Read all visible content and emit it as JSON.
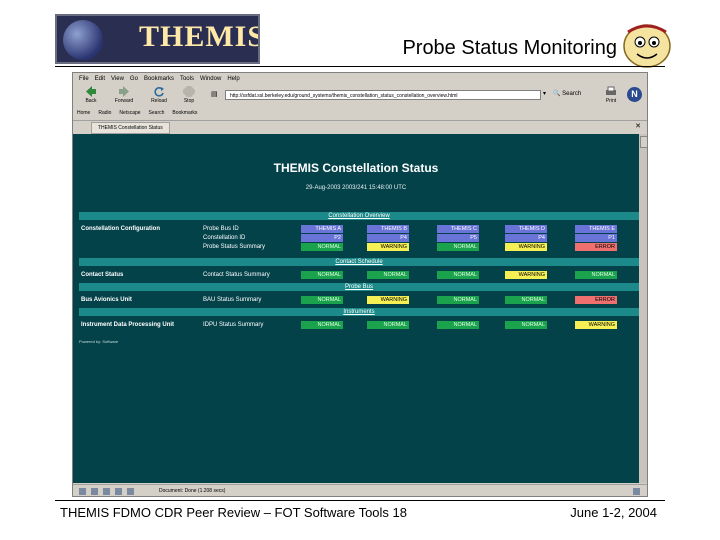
{
  "slide": {
    "title": "Probe Status Monitoring",
    "logo_text": "THEMIS",
    "footer_left": "THEMIS FDMO CDR Peer Review – FOT Software Tools 18",
    "footer_right": "June 1-2, 2004"
  },
  "browser": {
    "menu": [
      "File",
      "Edit",
      "View",
      "Go",
      "Bookmarks",
      "Tools",
      "Window",
      "Help"
    ],
    "nav": {
      "back": "Back",
      "forward": "Forward",
      "reload": "Reload",
      "stop": "Stop"
    },
    "url": "http://ssfdat.ssl.berkeley.edu/ground_systems/themis_constellation_status_constellation_overview.html",
    "search_label": "Search",
    "print_label": "Print",
    "bookmarks": [
      "Home",
      "Radio",
      "Netscape",
      "Search",
      "Bookmarks"
    ],
    "tab_title": "THEMIS Constellation Status",
    "status_text": "Document: Done (1.208 secs)"
  },
  "page": {
    "title": "THEMIS Constellation Status",
    "subtitle": "29-Aug-2003 2003/241 15:48:00 UTC",
    "sections": {
      "overview": "Constellation Overview",
      "contact": "Contact Schedule",
      "bus": "Probe Bus",
      "instruments": "Instruments"
    },
    "rows": {
      "constellation": {
        "label": "Constellation Configuration",
        "metrics": [
          "Probe Bus ID",
          "Constellation ID",
          "Probe Status Summary"
        ]
      },
      "contact": {
        "label": "Contact Status",
        "metric": "Contact Status Summary"
      },
      "bus": {
        "label": "Bus Avionics Unit",
        "metric": "BAU Status Summary"
      },
      "idpu": {
        "label": "Instrument Data Processing Unit",
        "metric": "IDPU Status Summary"
      }
    },
    "probes": [
      "THEMIS A",
      "THEMIS B",
      "THEMIS C",
      "THEMIS D",
      "THEMIS E"
    ],
    "constellation_ids": [
      "P2",
      "P4",
      "P5",
      "P4",
      "P1"
    ],
    "status_summary": [
      "NORMAL",
      "WARNING",
      "NORMAL",
      "WARNING",
      "ERROR"
    ],
    "contact_status": [
      "NORMAL",
      "NORMAL",
      "NORMAL",
      "WARNING",
      "NORMAL"
    ],
    "bau_status": [
      "NORMAL",
      "WARNING",
      "NORMAL",
      "NORMAL",
      "ERROR"
    ],
    "idpu_status": [
      "NORMAL",
      "NORMAL",
      "NORMAL",
      "NORMAL",
      "WARNING"
    ],
    "powered_by": "Powered by: Software"
  },
  "colors": {
    "background": "#04424a",
    "section_bar": "#1c8a8a",
    "normal": "#1aa24c",
    "warning": "#f6f055",
    "error": "#f07070",
    "header_cell": "#6a73d8"
  }
}
